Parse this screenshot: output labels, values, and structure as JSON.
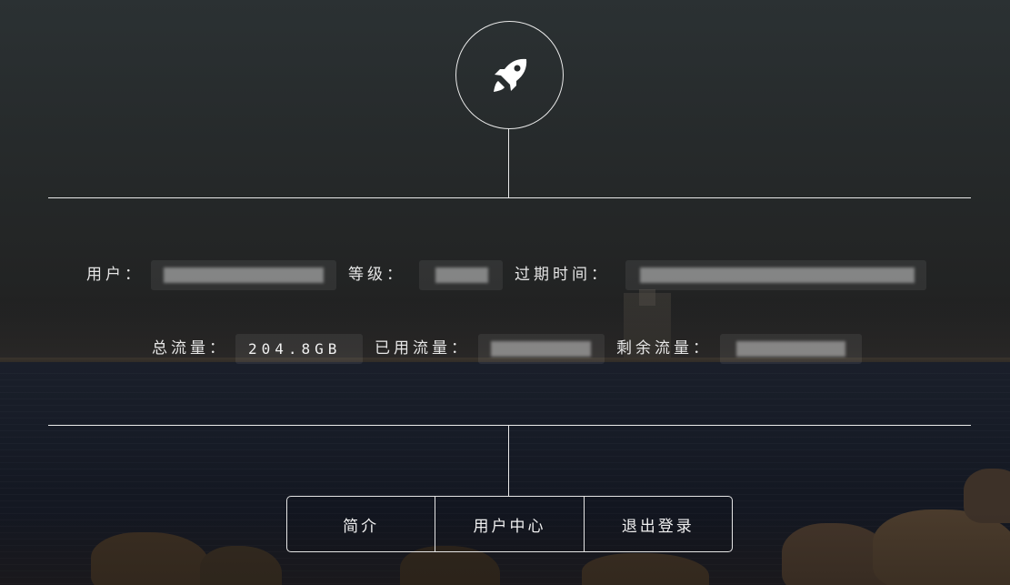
{
  "logo": {
    "icon": "rocket-icon"
  },
  "info": {
    "user_label": "用户：",
    "level_label": "等级：",
    "expire_label": "过期时间：",
    "total_label": "总流量：",
    "total_value": "204.8GB",
    "used_label": "已用流量：",
    "remain_label": "剩余流量："
  },
  "nav": {
    "intro": "简介",
    "user_center": "用户中心",
    "logout": "退出登录"
  },
  "colors": {
    "line": "#e9e9e9",
    "text": "#e6e6e6"
  }
}
